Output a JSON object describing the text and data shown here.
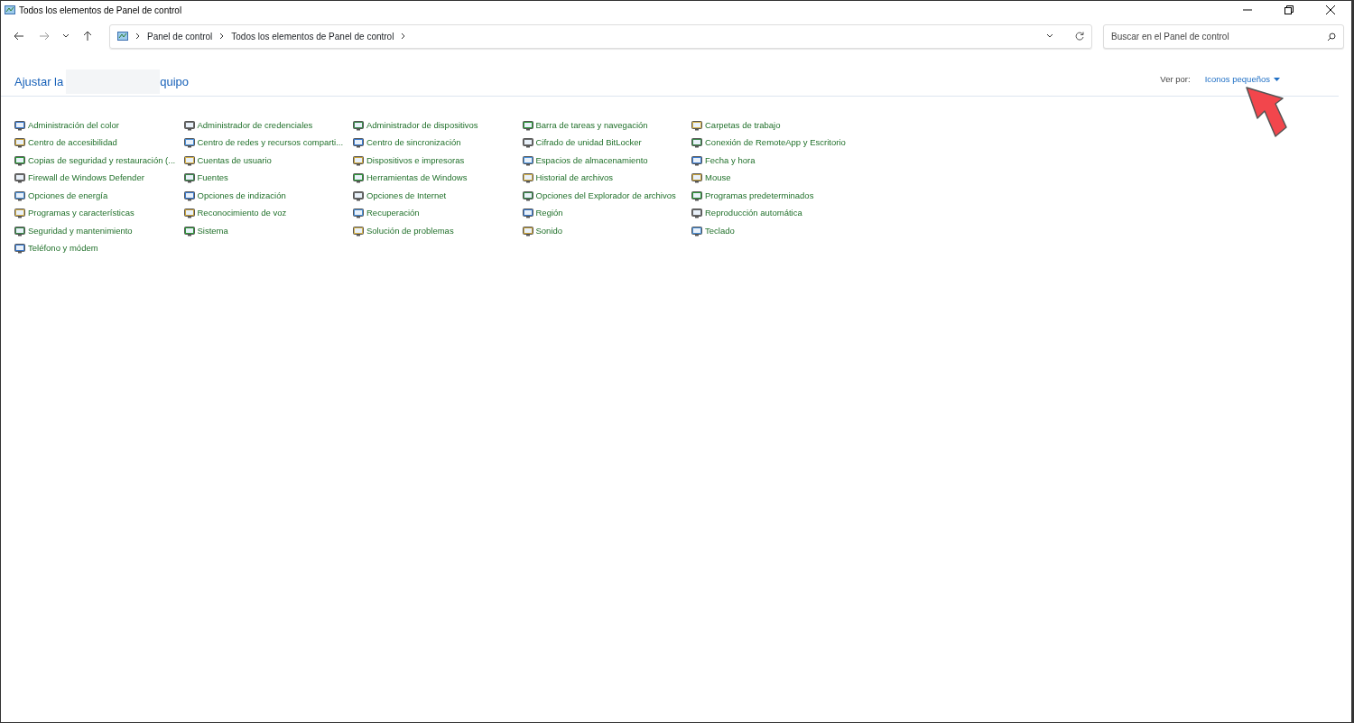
{
  "window": {
    "title": "Todos los elementos de Panel de control"
  },
  "address_bar": {
    "breadcrumbs": [
      "Panel de control",
      "Todos los elementos de Panel de control"
    ]
  },
  "search": {
    "placeholder": "Buscar en el Panel de control"
  },
  "heading": {
    "before": "Ajustar la",
    "after": "quipo",
    "redacted": true
  },
  "view_by": {
    "label": "Ver por:",
    "value": "Iconos pequeños"
  },
  "columns": [
    [
      {
        "label": "Administración del color"
      },
      {
        "label": "Centro de accesibilidad"
      },
      {
        "label": "Copias de seguridad y restauración (..."
      },
      {
        "label": "Firewall de Windows Defender"
      },
      {
        "label": "Opciones de energía"
      },
      {
        "label": "Programas y características"
      },
      {
        "label": "Seguridad y mantenimiento"
      },
      {
        "label": "Teléfono y módem"
      }
    ],
    [
      {
        "label": "Administrador de credenciales"
      },
      {
        "label": "Centro de redes y recursos comparti..."
      },
      {
        "label": "Cuentas de usuario"
      },
      {
        "label": "Fuentes"
      },
      {
        "label": "Opciones de indización"
      },
      {
        "label": "Reconocimiento de voz"
      },
      {
        "label": "Sistema"
      }
    ],
    [
      {
        "label": "Administrador de dispositivos"
      },
      {
        "label": "Centro de sincronización"
      },
      {
        "label": "Dispositivos e impresoras"
      },
      {
        "label": "Herramientas de Windows"
      },
      {
        "label": "Opciones de Internet"
      },
      {
        "label": "Recuperación"
      },
      {
        "label": "Solución de problemas"
      }
    ],
    [
      {
        "label": "Barra de tareas y navegación"
      },
      {
        "label": "Cifrado de unidad BitLocker"
      },
      {
        "label": "Espacios de almacenamiento"
      },
      {
        "label": "Historial de archivos"
      },
      {
        "label": "Opciones del Explorador de archivos"
      },
      {
        "label": "Región"
      },
      {
        "label": "Sonido"
      }
    ],
    [
      {
        "label": "Carpetas de trabajo"
      },
      {
        "label": "Conexión de RemoteApp y Escritorio"
      },
      {
        "label": "Fecha y hora"
      },
      {
        "label": "Mouse"
      },
      {
        "label": "Programas predeterminados"
      },
      {
        "label": "Reproducción automática"
      },
      {
        "label": "Teclado"
      }
    ]
  ],
  "annotation": {
    "kind": "arrow"
  }
}
